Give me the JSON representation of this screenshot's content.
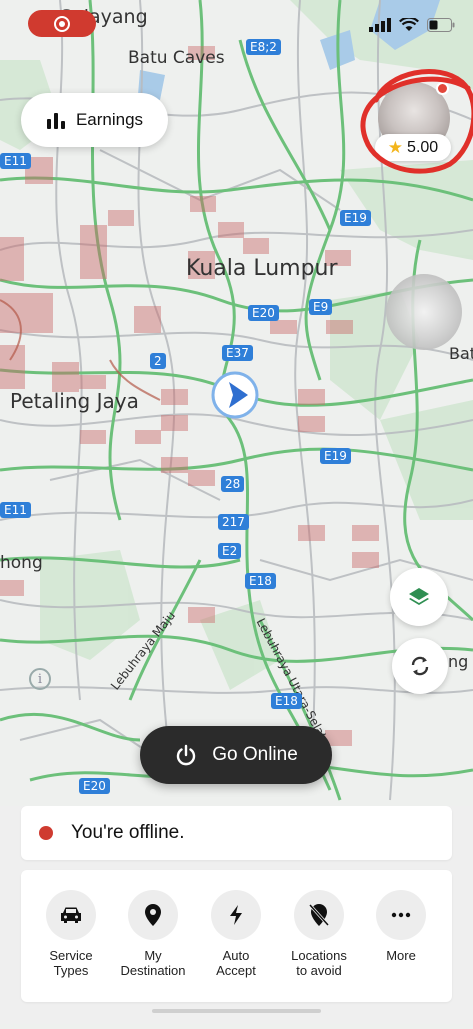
{
  "status_bar": {
    "recording_indicator": "screen-record-icon",
    "icons": [
      "signal-icon",
      "wifi-icon",
      "battery-icon"
    ]
  },
  "map": {
    "places": {
      "top_left_partial": "Selayang",
      "batu_caves": "Batu Caves",
      "kuala_lumpur": "Kuala Lumpur",
      "petaling_jaya": "Petaling Jaya",
      "left_partial": "hong",
      "right_partial_top": "Bat",
      "right_partial_bottom": "ng"
    },
    "roads": {
      "lebuhraya_maju": "Lebuhraya Maju",
      "lebuhraya_utara_selatan": "Lebuhraya Utara-Selatan"
    },
    "shields": {
      "e8_2": "E8;2",
      "e11_a": "E11",
      "e19_a": "E19",
      "e20_a": "E20",
      "e9": "E9",
      "e37": "E37",
      "two": "2",
      "e19_b": "E19",
      "twenty_eight": "28",
      "e11_b": "E11",
      "two_seventeen": "217",
      "e2": "E2",
      "e18_a": "E18",
      "e18_b": "E18",
      "e20_b": "E20"
    }
  },
  "earnings": {
    "label": "Earnings",
    "icon": "bar-chart-icon"
  },
  "profile": {
    "rating": "5.00",
    "star_icon": "star-icon"
  },
  "controls": {
    "layers_icon": "layers-icon",
    "recenter_icon": "refresh-icon",
    "info_icon": "info-icon"
  },
  "go_online": {
    "label": "Go Online",
    "icon": "power-icon"
  },
  "status": {
    "text": "You're offline.",
    "dot_color": "#cf3b30"
  },
  "quick_actions": [
    {
      "label": "Service Types",
      "icon": "car-icon"
    },
    {
      "label": "My Destination",
      "icon": "location-pin-icon"
    },
    {
      "label": "Auto Accept",
      "icon": "lightning-icon"
    },
    {
      "label": "Locations to avoid",
      "icon": "location-off-icon"
    },
    {
      "label": "More",
      "icon": "more-dots-icon"
    }
  ],
  "colors": {
    "accent_green": "#2f8f52",
    "road_green": "#6cc07a",
    "highway_blue": "#2f7fd8",
    "go_online_bg": "#2b2b2b",
    "recording_red": "#d03a2f"
  }
}
